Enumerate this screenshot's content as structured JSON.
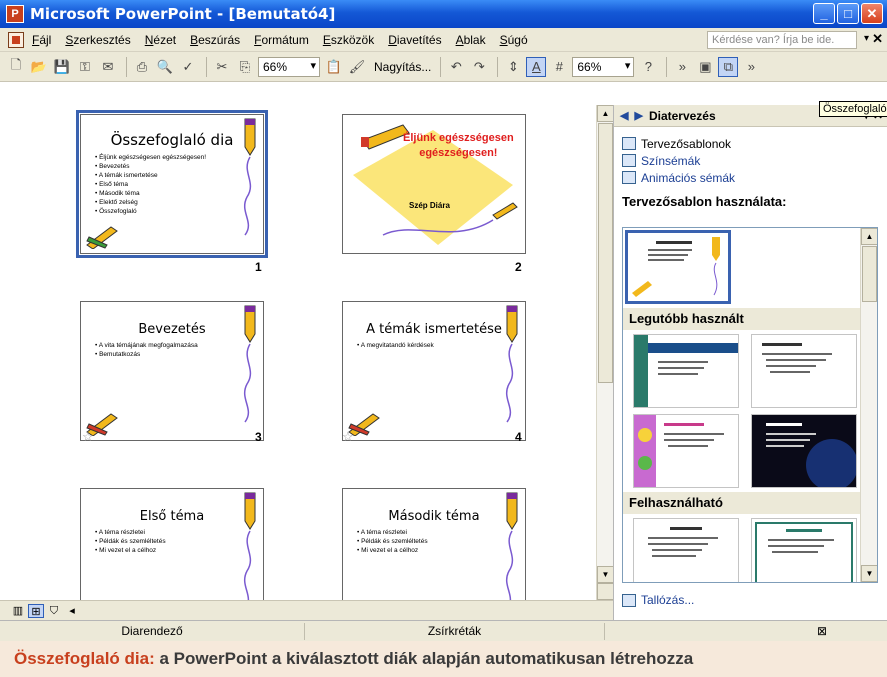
{
  "window": {
    "title": "Microsoft PowerPoint - [Bemutató4]",
    "app_icon": "P"
  },
  "menu": {
    "items": [
      "Fájl",
      "Szerkesztés",
      "Nézet",
      "Beszúrás",
      "Formátum",
      "Eszközök",
      "Diavetítés",
      "Ablak",
      "Súgó"
    ],
    "help_placeholder": "Kérdése van? Írja be ide."
  },
  "toolbar": {
    "zoom1": "66%",
    "zoom_label": "Nagyítás...",
    "zoom2": "66%"
  },
  "slides": [
    {
      "number": "1",
      "title": "Összefoglaló dia",
      "bullets": [
        "Éljünk egészségesen egészségesen!",
        "Bevezetés",
        "A témák ismertetése",
        "Első téma",
        "Második téma",
        "Elektő zelség",
        "Összefoglaló"
      ],
      "selected": true
    },
    {
      "number": "2",
      "title_line1": "Éljünk egészségesen",
      "title_line2": "egészségesen!",
      "subtitle": "Szép Diára"
    },
    {
      "number": "3",
      "title": "Bevezetés",
      "bullets": [
        "A vita témájának megfogalmazása",
        "Bemutatkozás"
      ]
    },
    {
      "number": "4",
      "title": "A témák ismertetése",
      "bullets": [
        "A megvitatandó kérdések"
      ]
    },
    {
      "number": "",
      "title": "Első téma",
      "bullets": [
        "A téma részletei",
        "Példák és szemléltetés",
        "Mi vezet el a célhoz"
      ]
    },
    {
      "number": "",
      "title": "Második téma",
      "bullets": [
        "A téma részletei",
        "Példák és szemléltetés",
        "Mi vezet el a célhoz"
      ]
    }
  ],
  "taskpane": {
    "title": "Diatervezés",
    "tooltip": "Összefoglaló",
    "links": [
      "Tervezősablonok",
      "Színsémák",
      "Animációs sémák"
    ],
    "section_heading": "Tervezősablon használata:",
    "group_recent": "Legutóbb használt",
    "group_available": "Felhasználható",
    "browse": "Tallózás..."
  },
  "statusbar": {
    "left": "Diarendező",
    "center": "Zsírkréták"
  },
  "caption": {
    "highlight": "Összefoglaló dia:",
    "text": " a PowerPoint a kiválasztott diák alapján automatikusan létrehozza"
  }
}
